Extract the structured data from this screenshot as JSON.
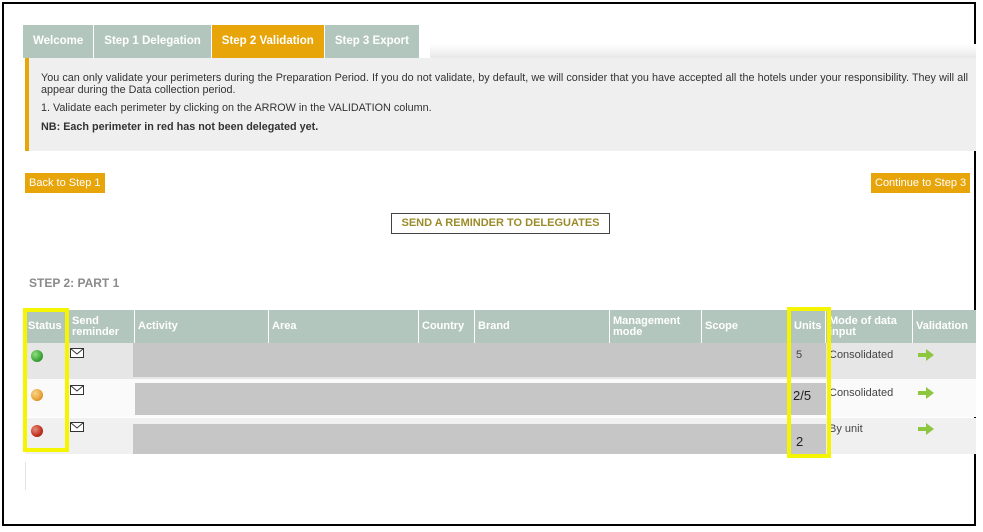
{
  "tabs": [
    {
      "label": "Welcome"
    },
    {
      "label": "Step 1 Delegation"
    },
    {
      "label": "Step 2 Validation"
    },
    {
      "label": "Step 3 Export"
    }
  ],
  "active_tab": "Step 2 Validation",
  "info": {
    "line1": "You can only validate your perimeters during the Preparation Period. If you do not validate, by default, we will consider that you have accepted all the hotels under your responsibility. They will all appear during the Data collection period.",
    "line2": "1. Validate each perimeter by clicking on the ARROW in the VALIDATION column.",
    "line3": "NB: Each perimeter in red has not been delegated yet."
  },
  "buttons": {
    "back": "Back to Step 1",
    "continue": "Continue to Step 3",
    "reminder": "SEND A REMINDER TO DELEGUATES"
  },
  "section_title": "STEP 2: PART 1",
  "columns": {
    "status": "Status",
    "send_reminder": "Send reminder",
    "activity": "Activity",
    "area": "Area",
    "country": "Country",
    "brand": "Brand",
    "management_mode": "Management mode",
    "scope": "Scope",
    "units": "Units",
    "mode_of_data_input": "Mode of data input",
    "validation": "Validation"
  },
  "rows": [
    {
      "status_color": "#3ea43a",
      "units": "5",
      "mode": "Consolidated"
    },
    {
      "status_color": "#e8a233",
      "units": "2/5",
      "mode": "Consolidated"
    },
    {
      "status_color": "#c0301f",
      "units": "2",
      "mode": "By unit"
    }
  ],
  "colors": {
    "accent": "#e8a50a",
    "header": "#b3c6be",
    "highlight": "#f5f500"
  },
  "icons": {
    "send_reminder": "envelope-icon",
    "validation": "green-arrow-icon"
  }
}
